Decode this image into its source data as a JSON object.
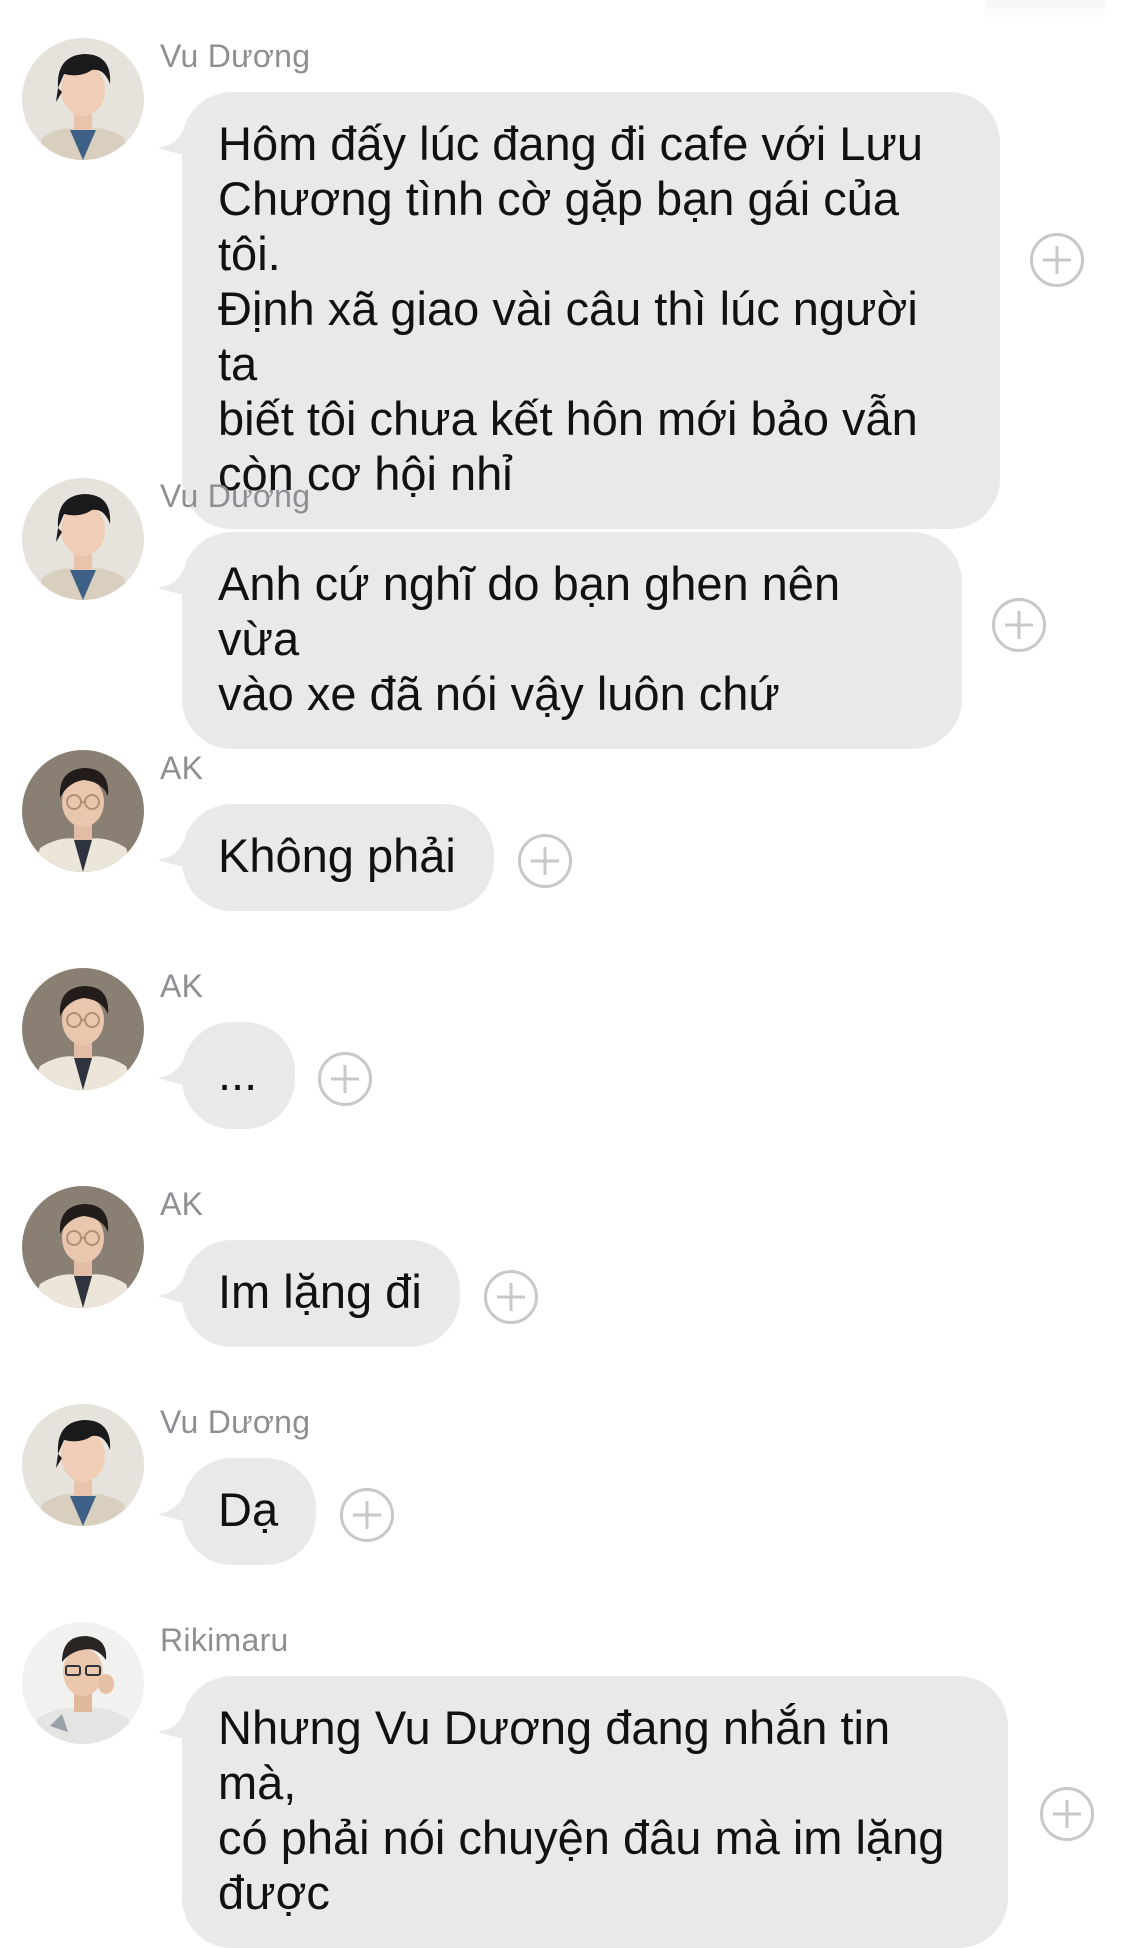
{
  "messages": [
    {
      "sender": "Vu Dương",
      "avatar": "vu-duong-avatar",
      "text": "Hôm đấy lúc đang đi cafe với Lưu\nChương tình cờ gặp bạn gái của tôi.\nĐịnh xã giao vài câu thì lúc người ta\nbiết tôi chưa kết hôn mới bảo vẫn\ncòn cơ hội nhỉ"
    },
    {
      "sender": "Vu Dương",
      "avatar": "vu-duong-avatar",
      "text": "Anh cứ nghĩ do bạn ghen nên vừa\nvào xe đã nói vậy luôn chứ"
    },
    {
      "sender": "AK",
      "avatar": "ak-avatar",
      "text": "Không phải"
    },
    {
      "sender": "AK",
      "avatar": "ak-avatar",
      "text": "..."
    },
    {
      "sender": "AK",
      "avatar": "ak-avatar",
      "text": "Im lặng đi"
    },
    {
      "sender": "Vu Dương",
      "avatar": "vu-duong-avatar",
      "text": "Dạ"
    },
    {
      "sender": "Rikimaru",
      "avatar": "rikimaru-avatar",
      "text": "Nhưng Vu Dương đang nhắn tin mà,\ncó phải nói chuyện đâu mà im lặng\nđược"
    }
  ],
  "icons": {
    "reaction": "add-reaction-icon"
  },
  "colors": {
    "bubble": "#e9e9eb",
    "sender": "#8e8e93",
    "text": "#111111",
    "reaction": "#c8c8cc"
  }
}
